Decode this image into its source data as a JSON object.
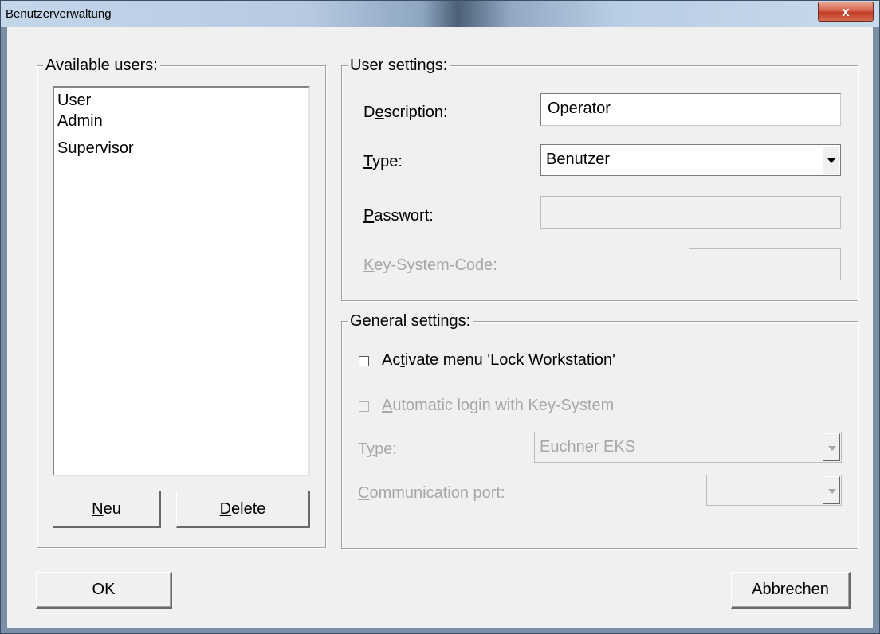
{
  "window": {
    "title": "Benutzerverwaltung",
    "close_glyph": "x"
  },
  "available_users": {
    "legend": "Available users:",
    "items": [
      "User",
      "Admin",
      "Supervisor"
    ],
    "new_button": {
      "accel": "N",
      "rest": "eu"
    },
    "delete_button": {
      "accel": "D",
      "rest": "elete"
    }
  },
  "user_settings": {
    "legend": "User settings:",
    "description": {
      "pre": "D",
      "accel": "e",
      "post": "scription:",
      "value": "Operator"
    },
    "type": {
      "pre": "",
      "accel": "T",
      "post": "ype:",
      "value": "Benutzer"
    },
    "password": {
      "pre": "",
      "accel": "P",
      "post": "asswort:",
      "value": ""
    },
    "key_system_code": {
      "pre": "",
      "accel": "K",
      "post": "ey-System-Code:",
      "value": ""
    }
  },
  "general_settings": {
    "legend": "General settings:",
    "lock_workstation": {
      "pre": "Ac",
      "accel": "t",
      "post": "ivate menu 'Lock Workstation'",
      "checked": false
    },
    "auto_login": {
      "pre": "",
      "accel": "A",
      "post": "utomatic login with Key-System",
      "checked": false
    },
    "type": {
      "pre": "T",
      "accel": "y",
      "post": "pe:",
      "value": "Euchner EKS"
    },
    "comm_port": {
      "pre": "",
      "accel": "C",
      "post": "ommunication port:",
      "value": ""
    }
  },
  "footer": {
    "ok_label": "OK",
    "cancel_label": "Abbrechen"
  },
  "icons": {
    "close": "close-icon",
    "dropdown": "chevron-down-icon",
    "checkbox": "checkbox-icon"
  }
}
